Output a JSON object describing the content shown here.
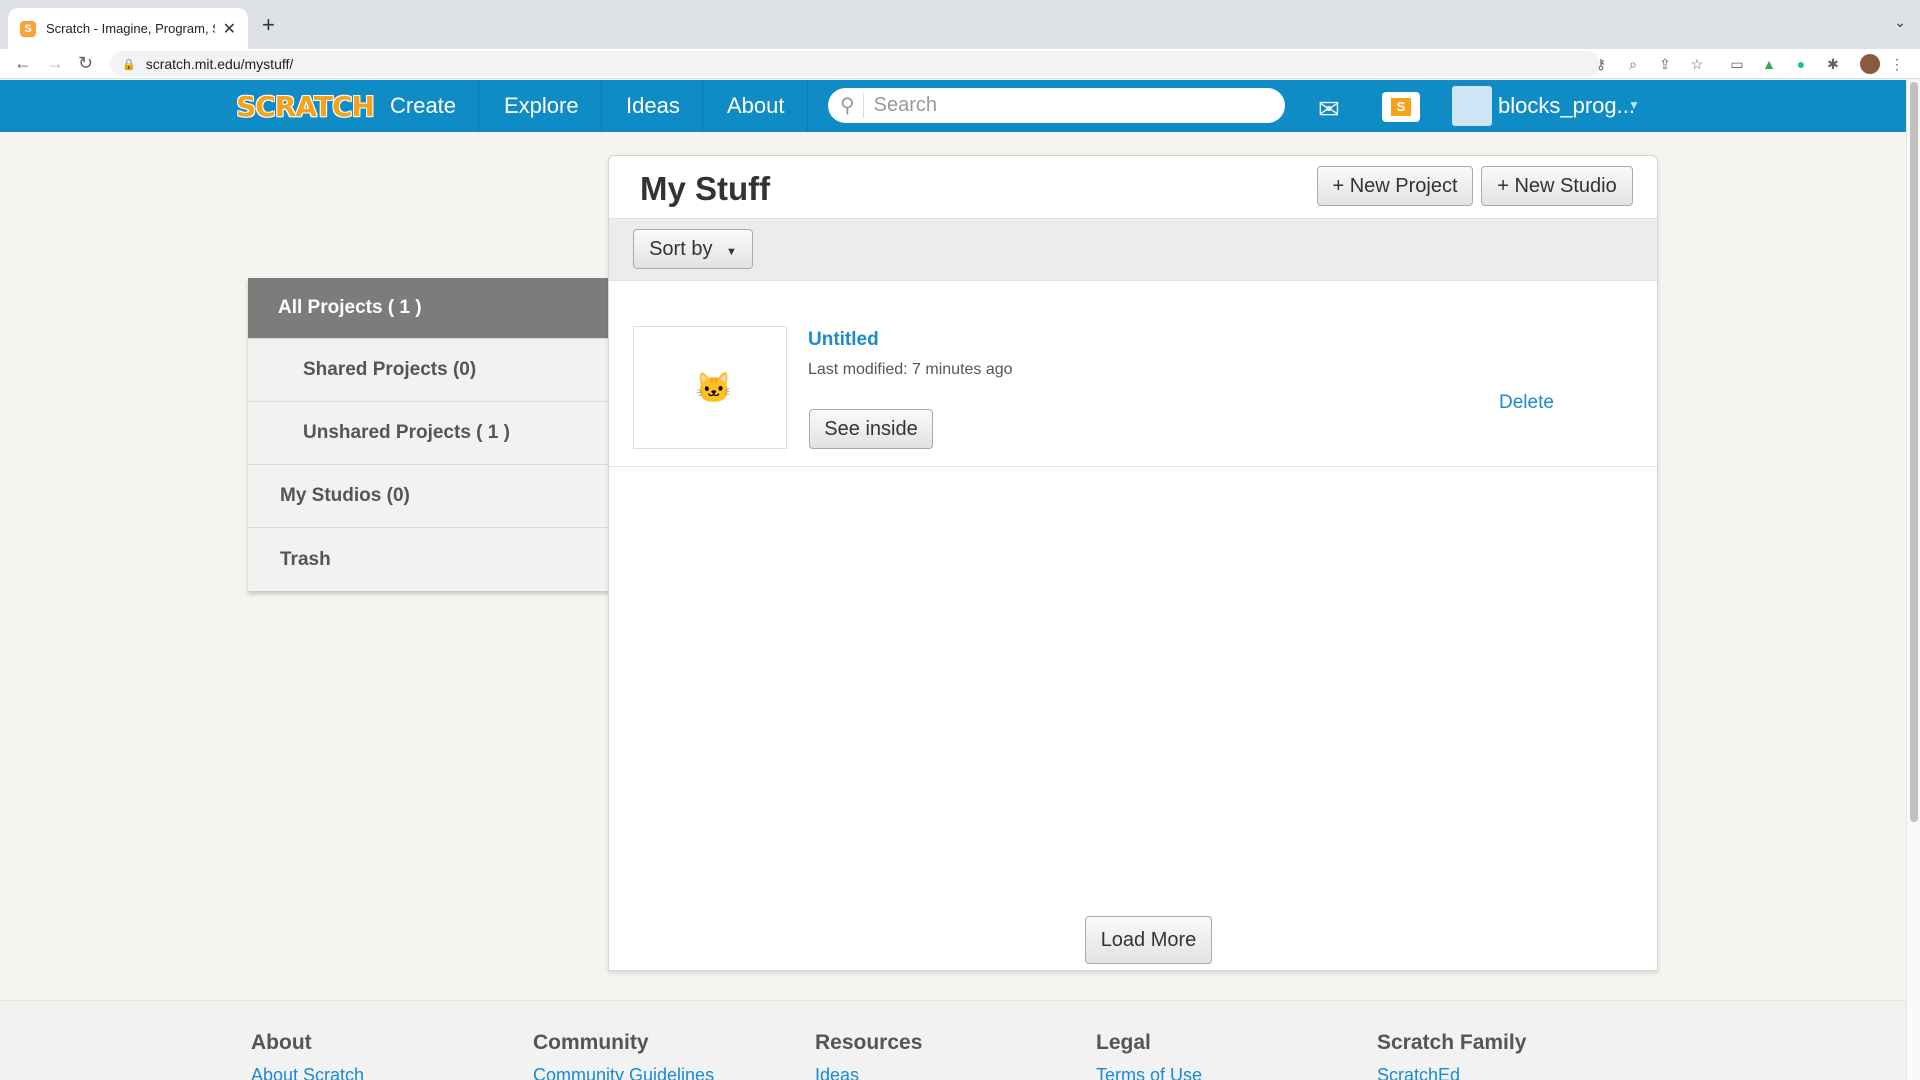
{
  "browser": {
    "tab_title": "Scratch - Imagine, Program, Sh",
    "tab_favicon": "S",
    "url": "scratch.mit.edu/mystuff/"
  },
  "header": {
    "logo": "SCRATCH",
    "nav": [
      "Create",
      "Explore",
      "Ideas",
      "About"
    ],
    "search_placeholder": "Search",
    "username": "blocks_prog...",
    "stuff_icon_letter": "S"
  },
  "sidebar": {
    "items": [
      "All Projects ( 1 )",
      "Shared Projects (0)",
      "Unshared Projects ( 1 )",
      "My Studios (0)",
      "Trash"
    ]
  },
  "main": {
    "title": "My Stuff",
    "new_project": "+ New Project",
    "new_studio": "+ New Studio",
    "sort_by": "Sort by",
    "project": {
      "name": "Untitled",
      "last_modified": "Last modified: 7 minutes ago",
      "see_inside": "See inside",
      "delete": "Delete"
    },
    "load_more": "Load More"
  },
  "footer": {
    "columns": [
      {
        "heading": "About",
        "first_link": "About Scratch"
      },
      {
        "heading": "Community",
        "first_link": "Community Guidelines"
      },
      {
        "heading": "Resources",
        "first_link": "Ideas"
      },
      {
        "heading": "Legal",
        "first_link": "Terms of Use"
      },
      {
        "heading": "Scratch Family",
        "first_link": "ScratchEd"
      }
    ]
  },
  "colors": {
    "header_blue": "#0f8bc6",
    "link_blue": "#1b8ad0",
    "logo_orange": "#f7a21b",
    "sidebar_active": "#7c7c7c"
  }
}
